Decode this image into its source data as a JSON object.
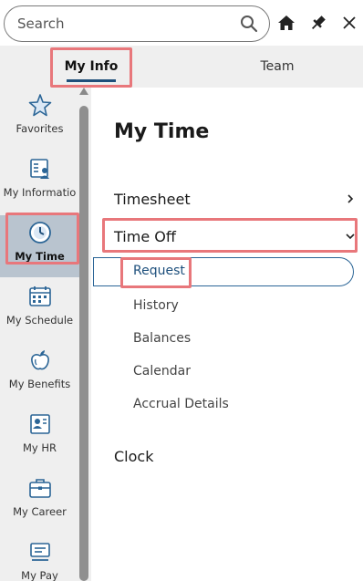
{
  "header": {
    "search_placeholder": "Search",
    "icons": [
      "search-icon",
      "home-icon",
      "pin-icon",
      "close-icon"
    ]
  },
  "tabs": [
    {
      "label": "My Info",
      "active": true
    },
    {
      "label": "Team",
      "active": false
    }
  ],
  "sidebar": {
    "items": [
      {
        "label": "Favorites",
        "icon": "star-icon"
      },
      {
        "label": "My Informatio",
        "icon": "profile-card-icon"
      },
      {
        "label": "My Time",
        "icon": "clock-icon",
        "active": true
      },
      {
        "label": "My Schedule",
        "icon": "calendar-icon"
      },
      {
        "label": "My Benefits",
        "icon": "apple-icon"
      },
      {
        "label": "My HR",
        "icon": "hr-icon"
      },
      {
        "label": "My Career",
        "icon": "briefcase-icon"
      },
      {
        "label": "My Pay",
        "icon": "pay-icon"
      }
    ]
  },
  "main": {
    "title": "My Time",
    "menu": [
      {
        "label": "Timesheet",
        "expanded": false
      },
      {
        "label": "Time Off",
        "expanded": true,
        "children": [
          "Request",
          "History",
          "Balances",
          "Calendar",
          "Accrual Details"
        ]
      },
      {
        "label": "Clock"
      }
    ]
  },
  "colors": {
    "accent": "#1e4f7a",
    "highlight_box": "#e8777b",
    "active_nav_bg": "#b9c4cf",
    "icon_blue": "#2b6596"
  }
}
